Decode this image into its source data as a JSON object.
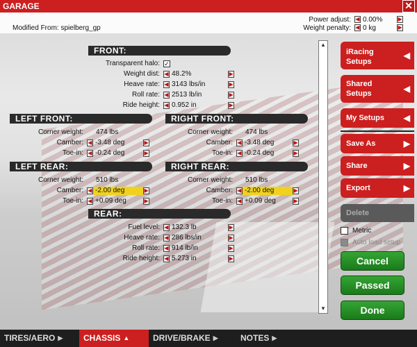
{
  "window": {
    "title": "GARAGE",
    "close": "✕"
  },
  "modified_from": {
    "label": "Modified From:",
    "value": "spielberg_gp"
  },
  "power_adjust": {
    "label": "Power adjust:",
    "value": "0.00%"
  },
  "weight_penalty": {
    "label": "Weight penalty:",
    "value": "0 kg"
  },
  "front": {
    "header": "FRONT:",
    "transparent_halo_label": "Transparent halo:",
    "transparent_halo_checked": "✓",
    "weight_dist_label": "Weight dist:",
    "weight_dist": "48.2%",
    "heave_rate_label": "Heave rate:",
    "heave_rate": "3143 lbs/in",
    "roll_rate_label": "Roll rate:",
    "roll_rate": "2513 lb/in",
    "ride_height_label": "Ride height:",
    "ride_height": "0.952 in"
  },
  "left_front": {
    "header": "LEFT FRONT:",
    "corner_weight_label": "Corner weight:",
    "corner_weight": "474 lbs",
    "camber_label": "Camber:",
    "camber": "-3.48 deg",
    "toe_in_label": "Toe-in:",
    "toe_in": "-0.24 deg"
  },
  "right_front": {
    "header": "RIGHT FRONT:",
    "corner_weight_label": "Corner weight:",
    "corner_weight": "474 lbs",
    "camber_label": "Camber:",
    "camber": "-3.48 deg",
    "toe_in_label": "Toe-in:",
    "toe_in": "-0.24 deg"
  },
  "left_rear": {
    "header": "LEFT REAR:",
    "corner_weight_label": "Corner weight:",
    "corner_weight": "510 lbs",
    "camber_label": "Camber:",
    "camber": "-2.00 deg",
    "toe_in_label": "Toe-in:",
    "toe_in": "+0.09 deg"
  },
  "right_rear": {
    "header": "RIGHT REAR:",
    "corner_weight_label": "Corner weight:",
    "corner_weight": "510 lbs",
    "camber_label": "Camber:",
    "camber": "-2.00 deg",
    "toe_in_label": "Toe-in:",
    "toe_in": "+0.09 deg"
  },
  "rear": {
    "header": "REAR:",
    "fuel_level_label": "Fuel level:",
    "fuel_level": "132.3 lb",
    "heave_rate_label": "Heave rate:",
    "heave_rate": "286 lbs/in",
    "roll_rate_label": "Roll rate:",
    "roll_rate": "914 lb/in",
    "ride_height_label": "Ride height:",
    "ride_height": "5.273 in"
  },
  "panel": {
    "iracing_setups_1": "iRacing",
    "iracing_setups_2": "Setups",
    "shared_setups_1": "Shared",
    "shared_setups_2": "Setups",
    "my_setups": "My Setups",
    "save_as": "Save As",
    "share": "Share",
    "export": "Export",
    "delete": "Delete",
    "metric": "Metric",
    "auto_load": "Auto load setup",
    "cancel": "Cancel",
    "passed": "Passed",
    "done": "Done"
  },
  "tabs": {
    "tires_aero": "TIRES/AERO",
    "chassis": "CHASSIS",
    "drive_brake": "DRIVE/BRAKE",
    "notes": "NOTES"
  },
  "colors": {
    "accent": "#cc1f1f",
    "highlight": "#f0d21e",
    "green": "#22882a",
    "dark": "#2a2a2a"
  }
}
